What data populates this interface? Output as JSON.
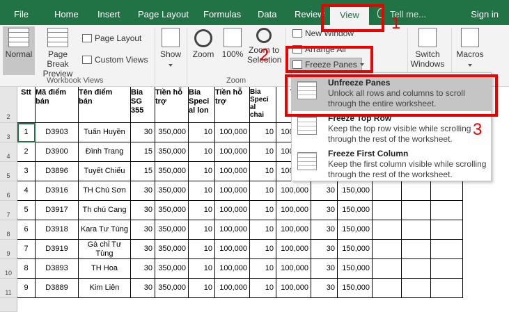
{
  "tabs": [
    "File",
    "Home",
    "Insert",
    "Page Layout",
    "Formulas",
    "Data",
    "Review",
    "View"
  ],
  "tell_me": "Tell me...",
  "sign_in": "Sign in",
  "ribbon": {
    "normal": "Normal",
    "page_break_1": "Page Break",
    "page_break_2": "Preview",
    "page_layout": "Page Layout",
    "custom_views": "Custom Views",
    "workbook_views": "Workbook Views",
    "show": "Show",
    "zoom": "Zoom",
    "zoom100": "100%",
    "zoom_sel_1": "Zoom to",
    "zoom_sel_2": "Selection",
    "zoom_group": "Zoom",
    "new_window": "New Window",
    "arrange_all": "Arrange All",
    "freeze_panes": "Freeze Panes",
    "switch_1": "Switch",
    "switch_2": "Windows",
    "macros": "Macros"
  },
  "annotations": [
    "1",
    "2",
    "3"
  ],
  "row_numbers": [
    "2",
    "3",
    "4",
    "5",
    "6",
    "7",
    "8",
    "9",
    "10",
    "11"
  ],
  "headers": {
    "stt": "Stt",
    "ma_1": "Mã điểm",
    "ma_2": "bán",
    "ten_1": "Tên điểm",
    "ten_2": "bán",
    "bia_sg_1": "Bia",
    "bia_sg_2": "SG",
    "bia_sg_3": "355",
    "tien_1": "Tiền hỗ",
    "tien_2": "trợ",
    "bia_sl_1": "Bia",
    "bia_sl_2": "Speci",
    "bia_sl_3": "al lon",
    "tien2_1": "Tiền hỗ",
    "tien2_2": "trợ",
    "bia_sc_1": "Bia",
    "bia_sc_2": "Speci",
    "bia_sc_3": "al",
    "bia_sc_4": "chai",
    "tien3": "Ti"
  },
  "rows": [
    {
      "stt": "1",
      "ma": "D3903",
      "ten": "Tuấn Huyền",
      "sg": "30",
      "t1": "350,000",
      "sl": "10",
      "t2": "100,000",
      "sc": "10",
      "t3": "100,000",
      "c10": "",
      "c11": ""
    },
    {
      "stt": "2",
      "ma": "D3900",
      "ten": "Đình Trang",
      "sg": "15",
      "t1": "350,000",
      "sl": "10",
      "t2": "100,000",
      "sc": "10",
      "t3": "100,000",
      "c10": "",
      "c11": ""
    },
    {
      "stt": "3",
      "ma": "D3896",
      "ten": "Tuyết Chiểu",
      "sg": "15",
      "t1": "350,000",
      "sl": "10",
      "t2": "100,000",
      "sc": "10",
      "t3": "100,000",
      "c10": "",
      "c11": ""
    },
    {
      "stt": "4",
      "ma": "D3916",
      "ten": "TH Chú Sơn",
      "sg": "30",
      "t1": "350,000",
      "sl": "10",
      "t2": "100,000",
      "sc": "10",
      "t3": "100,000",
      "c10": "30",
      "c11": "150,000"
    },
    {
      "stt": "5",
      "ma": "D3917",
      "ten": "Th chú Cang",
      "sg": "30",
      "t1": "350,000",
      "sl": "10",
      "t2": "100,000",
      "sc": "10",
      "t3": "100,000",
      "c10": "30",
      "c11": "150,000"
    },
    {
      "stt": "6",
      "ma": "D3918",
      "ten": "Kara Tư Tùng",
      "sg": "30",
      "t1": "350,000",
      "sl": "10",
      "t2": "100,000",
      "sc": "10",
      "t3": "100,000",
      "c10": "30",
      "c11": "150,000"
    },
    {
      "stt": "7",
      "ma": "D3919",
      "ten": "Gà chỉ Tư Tùng",
      "sg": "30",
      "t1": "350,000",
      "sl": "10",
      "t2": "100,000",
      "sc": "10",
      "t3": "100,000",
      "c10": "30",
      "c11": "150,000"
    },
    {
      "stt": "8",
      "ma": "D3893",
      "ten": "TH Hoa",
      "sg": "30",
      "t1": "350,000",
      "sl": "10",
      "t2": "100,000",
      "sc": "10",
      "t3": "100,000",
      "c10": "30",
      "c11": "150,000"
    },
    {
      "stt": "9",
      "ma": "D3889",
      "ten": "Kim Liên",
      "sg": "30",
      "t1": "350,000",
      "sl": "10",
      "t2": "100,000",
      "sc": "10",
      "t3": "100,000",
      "c10": "30",
      "c11": "150,000"
    }
  ],
  "menu": [
    {
      "title": "Unfreeze Panes",
      "desc": "Unlock all rows and columns to scroll through the entire worksheet."
    },
    {
      "title": "Freeze Top Row",
      "desc": "Keep the top row visible while scrolling through the rest of the worksheet."
    },
    {
      "title": "Freeze First Column",
      "desc": "Keep the first column visible while scrolling through the rest of the worksheet."
    }
  ],
  "colors": {
    "accent": "#217346",
    "annotation": "#e00000",
    "highlight": "#c5c5c5"
  }
}
